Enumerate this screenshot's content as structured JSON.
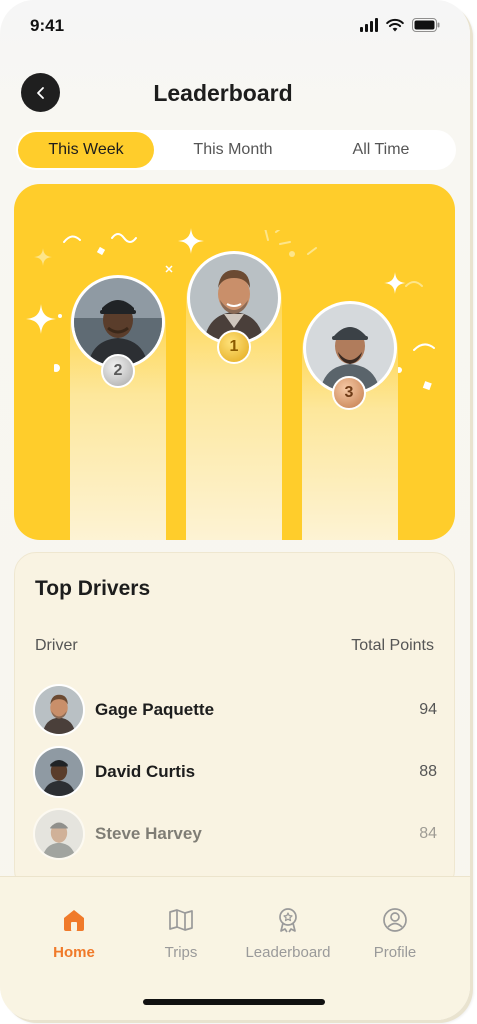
{
  "status": {
    "time": "9:41"
  },
  "header": {
    "title": "Leaderboard"
  },
  "tabs": [
    {
      "label": "This Week",
      "active": true
    },
    {
      "label": "This Month",
      "active": false
    },
    {
      "label": "All Time",
      "active": false
    }
  ],
  "podium": [
    {
      "rank": "1"
    },
    {
      "rank": "2"
    },
    {
      "rank": "3"
    }
  ],
  "top_drivers": {
    "title": "Top Drivers",
    "columns": {
      "driver": "Driver",
      "points": "Total Points"
    },
    "rows": [
      {
        "name": "Gage Paquette",
        "points": "94"
      },
      {
        "name": "David Curtis",
        "points": "88"
      },
      {
        "name": "Steve Harvey",
        "points": "84"
      }
    ]
  },
  "nav": {
    "items": [
      {
        "label": "Home",
        "icon": "home-icon",
        "active": true
      },
      {
        "label": "Trips",
        "icon": "map-icon",
        "active": false
      },
      {
        "label": "Leaderboard",
        "icon": "award-icon",
        "active": false
      },
      {
        "label": "Profile",
        "icon": "user-icon",
        "active": false
      }
    ]
  },
  "colors": {
    "accent": "#ffcd2b",
    "nav_active": "#f07a2a",
    "dark": "#1f1f1f"
  }
}
